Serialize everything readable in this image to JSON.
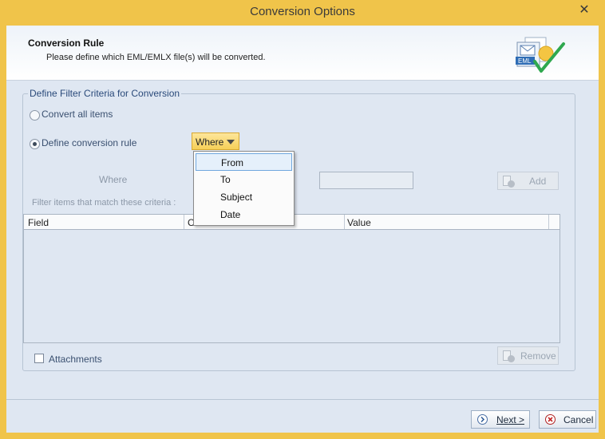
{
  "window": {
    "title": "Conversion Options",
    "close_glyph": "✕"
  },
  "header": {
    "title": "Conversion Rule",
    "description": "Please define which EML/EMLX file(s) will be converted.",
    "icon_text": "EML",
    "icon": "eml-checkmark-icon"
  },
  "group": {
    "legend": "Define Filter Criteria for Conversion",
    "option_all": "Convert all items",
    "option_rule": "Define conversion rule",
    "selected_option": "option_rule",
    "where_dropdown": {
      "value": "Where",
      "options": [
        "From",
        "To",
        "Subject",
        "Date"
      ],
      "highlighted": "From"
    },
    "where_label": "Where",
    "add_label": "Add",
    "filter_hint": "Filter items that match these criteria :",
    "table": {
      "columns": [
        "Field",
        "C",
        "Value"
      ],
      "rows": []
    },
    "attachments_label": "Attachments",
    "attachments_checked": false,
    "remove_label": "Remove"
  },
  "footer": {
    "next_label": "Next >",
    "cancel_label": "Cancel"
  },
  "colors": {
    "title_bar": "#f0c44a",
    "client_bg": "#dfe7f2",
    "dropdown": "#f6cf57",
    "menu_highlight": "#e5f0fb"
  }
}
